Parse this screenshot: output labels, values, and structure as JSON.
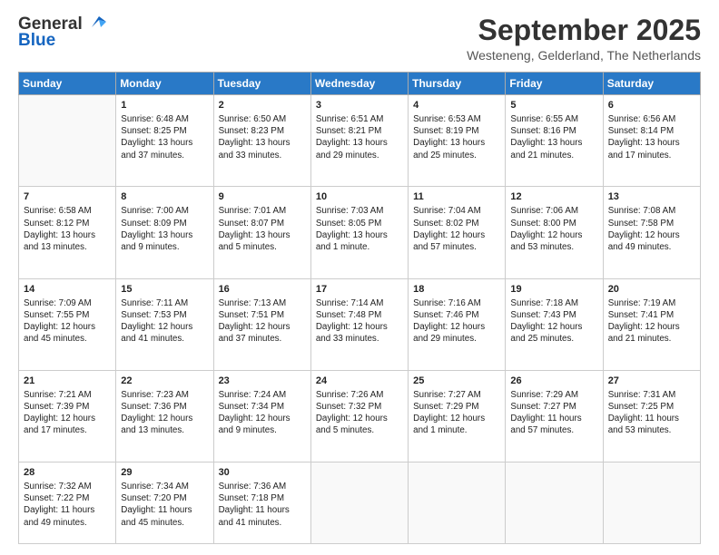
{
  "header": {
    "logo_general": "General",
    "logo_blue": "Blue",
    "month_title": "September 2025",
    "location": "Westeneng, Gelderland, The Netherlands"
  },
  "calendar": {
    "days_of_week": [
      "Sunday",
      "Monday",
      "Tuesday",
      "Wednesday",
      "Thursday",
      "Friday",
      "Saturday"
    ],
    "weeks": [
      [
        {
          "num": "",
          "info": ""
        },
        {
          "num": "1",
          "info": "Sunrise: 6:48 AM\nSunset: 8:25 PM\nDaylight: 13 hours\nand 37 minutes."
        },
        {
          "num": "2",
          "info": "Sunrise: 6:50 AM\nSunset: 8:23 PM\nDaylight: 13 hours\nand 33 minutes."
        },
        {
          "num": "3",
          "info": "Sunrise: 6:51 AM\nSunset: 8:21 PM\nDaylight: 13 hours\nand 29 minutes."
        },
        {
          "num": "4",
          "info": "Sunrise: 6:53 AM\nSunset: 8:19 PM\nDaylight: 13 hours\nand 25 minutes."
        },
        {
          "num": "5",
          "info": "Sunrise: 6:55 AM\nSunset: 8:16 PM\nDaylight: 13 hours\nand 21 minutes."
        },
        {
          "num": "6",
          "info": "Sunrise: 6:56 AM\nSunset: 8:14 PM\nDaylight: 13 hours\nand 17 minutes."
        }
      ],
      [
        {
          "num": "7",
          "info": "Sunrise: 6:58 AM\nSunset: 8:12 PM\nDaylight: 13 hours\nand 13 minutes."
        },
        {
          "num": "8",
          "info": "Sunrise: 7:00 AM\nSunset: 8:09 PM\nDaylight: 13 hours\nand 9 minutes."
        },
        {
          "num": "9",
          "info": "Sunrise: 7:01 AM\nSunset: 8:07 PM\nDaylight: 13 hours\nand 5 minutes."
        },
        {
          "num": "10",
          "info": "Sunrise: 7:03 AM\nSunset: 8:05 PM\nDaylight: 13 hours\nand 1 minute."
        },
        {
          "num": "11",
          "info": "Sunrise: 7:04 AM\nSunset: 8:02 PM\nDaylight: 12 hours\nand 57 minutes."
        },
        {
          "num": "12",
          "info": "Sunrise: 7:06 AM\nSunset: 8:00 PM\nDaylight: 12 hours\nand 53 minutes."
        },
        {
          "num": "13",
          "info": "Sunrise: 7:08 AM\nSunset: 7:58 PM\nDaylight: 12 hours\nand 49 minutes."
        }
      ],
      [
        {
          "num": "14",
          "info": "Sunrise: 7:09 AM\nSunset: 7:55 PM\nDaylight: 12 hours\nand 45 minutes."
        },
        {
          "num": "15",
          "info": "Sunrise: 7:11 AM\nSunset: 7:53 PM\nDaylight: 12 hours\nand 41 minutes."
        },
        {
          "num": "16",
          "info": "Sunrise: 7:13 AM\nSunset: 7:51 PM\nDaylight: 12 hours\nand 37 minutes."
        },
        {
          "num": "17",
          "info": "Sunrise: 7:14 AM\nSunset: 7:48 PM\nDaylight: 12 hours\nand 33 minutes."
        },
        {
          "num": "18",
          "info": "Sunrise: 7:16 AM\nSunset: 7:46 PM\nDaylight: 12 hours\nand 29 minutes."
        },
        {
          "num": "19",
          "info": "Sunrise: 7:18 AM\nSunset: 7:43 PM\nDaylight: 12 hours\nand 25 minutes."
        },
        {
          "num": "20",
          "info": "Sunrise: 7:19 AM\nSunset: 7:41 PM\nDaylight: 12 hours\nand 21 minutes."
        }
      ],
      [
        {
          "num": "21",
          "info": "Sunrise: 7:21 AM\nSunset: 7:39 PM\nDaylight: 12 hours\nand 17 minutes."
        },
        {
          "num": "22",
          "info": "Sunrise: 7:23 AM\nSunset: 7:36 PM\nDaylight: 12 hours\nand 13 minutes."
        },
        {
          "num": "23",
          "info": "Sunrise: 7:24 AM\nSunset: 7:34 PM\nDaylight: 12 hours\nand 9 minutes."
        },
        {
          "num": "24",
          "info": "Sunrise: 7:26 AM\nSunset: 7:32 PM\nDaylight: 12 hours\nand 5 minutes."
        },
        {
          "num": "25",
          "info": "Sunrise: 7:27 AM\nSunset: 7:29 PM\nDaylight: 12 hours\nand 1 minute."
        },
        {
          "num": "26",
          "info": "Sunrise: 7:29 AM\nSunset: 7:27 PM\nDaylight: 11 hours\nand 57 minutes."
        },
        {
          "num": "27",
          "info": "Sunrise: 7:31 AM\nSunset: 7:25 PM\nDaylight: 11 hours\nand 53 minutes."
        }
      ],
      [
        {
          "num": "28",
          "info": "Sunrise: 7:32 AM\nSunset: 7:22 PM\nDaylight: 11 hours\nand 49 minutes."
        },
        {
          "num": "29",
          "info": "Sunrise: 7:34 AM\nSunset: 7:20 PM\nDaylight: 11 hours\nand 45 minutes."
        },
        {
          "num": "30",
          "info": "Sunrise: 7:36 AM\nSunset: 7:18 PM\nDaylight: 11 hours\nand 41 minutes."
        },
        {
          "num": "",
          "info": ""
        },
        {
          "num": "",
          "info": ""
        },
        {
          "num": "",
          "info": ""
        },
        {
          "num": "",
          "info": ""
        }
      ]
    ]
  }
}
